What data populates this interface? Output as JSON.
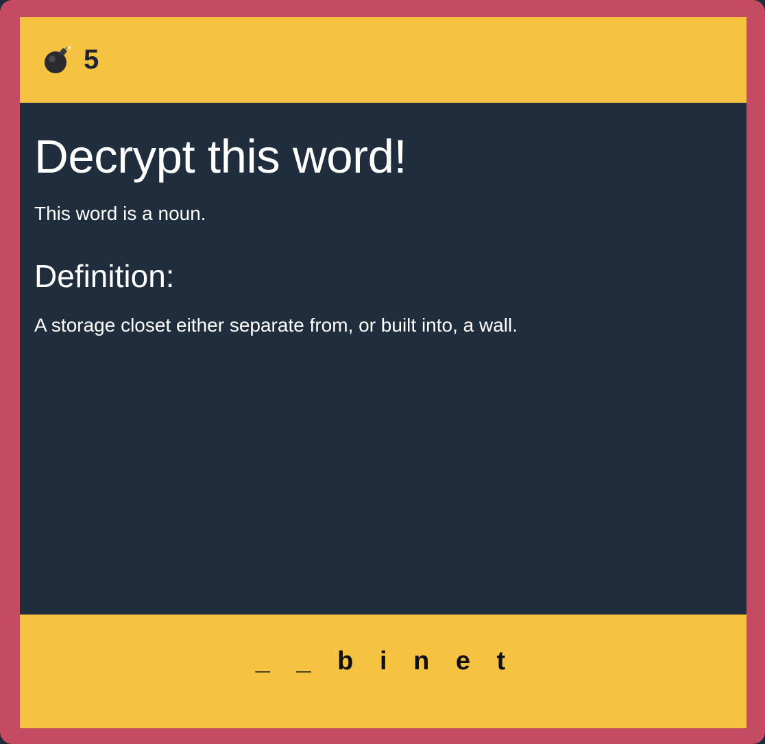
{
  "game": {
    "lives_icon": "bomb-icon",
    "lives": "5"
  },
  "challenge": {
    "title": "Decrypt this word!",
    "part_of_speech_text": "This word is a noun.",
    "definition_heading": "Definition:",
    "definition_text": "A storage closet either separate from, or built into, a wall."
  },
  "puzzle": {
    "masked_word": "_ _ b i n e t"
  },
  "colors": {
    "frame": "#c44b61",
    "accent": "#f5c242",
    "panel": "#1f2d3d",
    "text_light": "#ffffff",
    "text_dark": "#111111"
  }
}
